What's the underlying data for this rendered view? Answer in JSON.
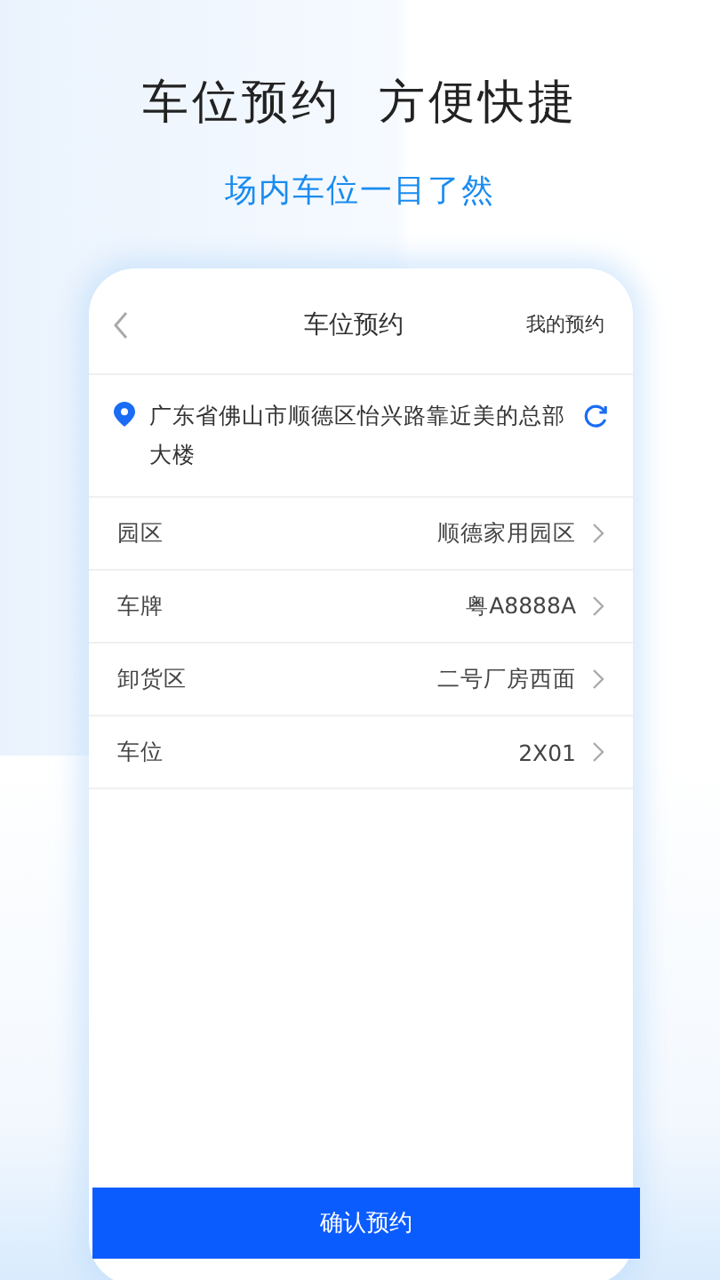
{
  "headline": "车位预约  方便快捷",
  "subtitle": "场内车位一目了然",
  "phone": {
    "nav": {
      "title": "车位预约",
      "action": "我的预约"
    },
    "address": "广东省佛山市顺德区怡兴路靠近美的总部大楼",
    "rows": [
      {
        "label": "园区",
        "value": "顺德家用园区"
      },
      {
        "label": "车牌",
        "value": "粤A8888A"
      },
      {
        "label": "卸货区",
        "value": "二号厂房西面"
      },
      {
        "label": "车位",
        "value": "2X01"
      }
    ],
    "confirm_button": "确认预约"
  }
}
